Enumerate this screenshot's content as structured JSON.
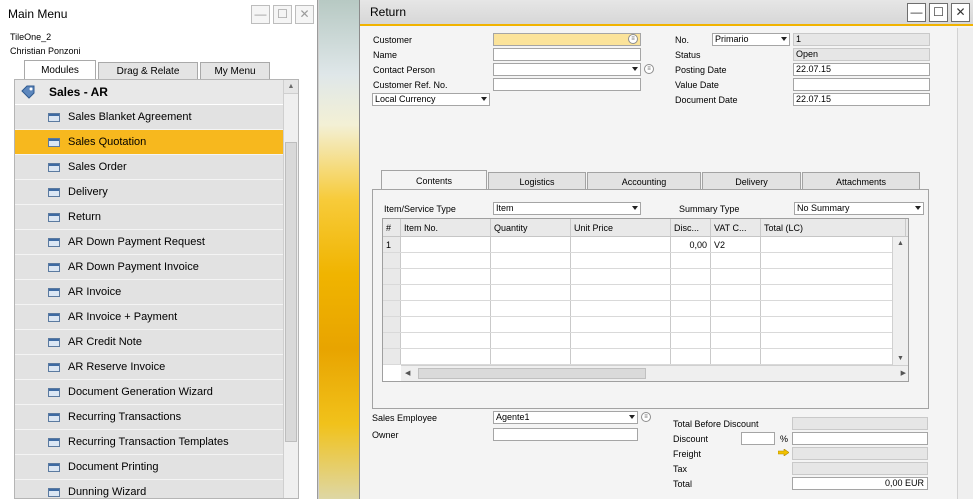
{
  "main_menu": {
    "title": "Main Menu",
    "company": "TileOne_2",
    "user": "Christian Ponzoni",
    "tabs": [
      "Modules",
      "Drag & Relate",
      "My Menu"
    ],
    "module_title": "Sales - AR",
    "items": [
      "Sales Blanket Agreement",
      "Sales Quotation",
      "Sales Order",
      "Delivery",
      "Return",
      "AR Down Payment Request",
      "AR Down Payment Invoice",
      "AR Invoice",
      "AR Invoice + Payment",
      "AR Credit Note",
      "AR Reserve Invoice",
      "Document Generation Wizard",
      "Recurring Transactions",
      "Recurring Transaction Templates",
      "Document Printing",
      "Dunning Wizard"
    ],
    "selected_index": 1
  },
  "return_form": {
    "title": "Return",
    "header_left": {
      "customer_label": "Customer",
      "name_label": "Name",
      "contact_label": "Contact Person",
      "ref_label": "Customer Ref. No.",
      "currency_value": "Local Currency"
    },
    "header_right": {
      "no_label": "No.",
      "series_value": "Primario",
      "no_value": "1",
      "status_label": "Status",
      "status_value": "Open",
      "posting_label": "Posting Date",
      "posting_value": "22.07.15",
      "value_date_label": "Value Date",
      "value_date_value": "",
      "doc_date_label": "Document Date",
      "doc_date_value": "22.07.15"
    },
    "tabs": [
      "Contents",
      "Logistics",
      "Accounting",
      "Delivery",
      "Attachments"
    ],
    "active_tab": 0,
    "item_type_label": "Item/Service Type",
    "item_type_value": "Item",
    "summary_type_label": "Summary Type",
    "summary_type_value": "No Summary",
    "grid": {
      "columns": [
        "#",
        "Item No.",
        "Quantity",
        "Unit Price",
        "Disc...",
        "VAT C...",
        "Total (LC)"
      ],
      "rows": [
        [
          "1",
          "",
          "",
          "",
          "0,00",
          "V2",
          ""
        ]
      ],
      "empty_rows": 7
    },
    "footer_left": {
      "sales_employee_label": "Sales Employee",
      "sales_employee_value": "Agente1",
      "owner_label": "Owner"
    },
    "footer_right": {
      "total_before_discount_label": "Total Before Discount",
      "discount_label": "Discount",
      "percent_sign": "%",
      "freight_label": "Freight",
      "tax_label": "Tax",
      "total_label": "Total",
      "total_value": "0,00 EUR"
    }
  }
}
